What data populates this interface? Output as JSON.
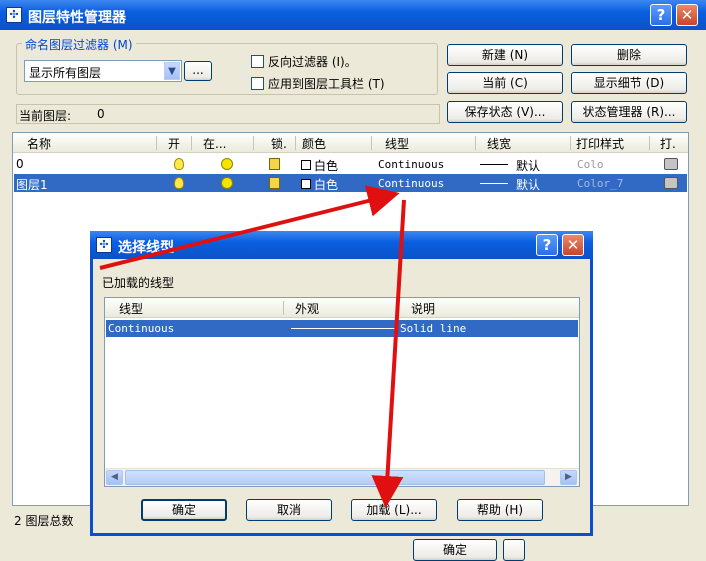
{
  "window": {
    "title": "图层特性管理器",
    "help": "?",
    "close": "✕"
  },
  "filter": {
    "group_label": "命名图层过滤器 (M)",
    "selected": "显示所有图层",
    "more": "...",
    "invert_label": "反向过滤器 (I)。",
    "apply_toolbar_label": "应用到图层工具栏 (T)"
  },
  "buttons": {
    "new": "新建 (N)",
    "delete": "删除",
    "current": "当前 (C)",
    "show_details": "显示细节 (D)",
    "save_state": "保存状态 (V)...",
    "state_manager": "状态管理器 (R)..."
  },
  "current_layer": {
    "label": "当前图层:",
    "value": "0"
  },
  "layer_table": {
    "columns": [
      "名称",
      "开",
      "在...",
      "锁.",
      "颜色",
      "线型",
      "线宽",
      "打印样式",
      "打."
    ],
    "rows": [
      {
        "name": "0",
        "color": "白色",
        "linetype": "Continuous",
        "lineweight": "默认",
        "plot_style": "Colo",
        "selected": false
      },
      {
        "name": "图层1",
        "color": "白色",
        "linetype": "Continuous",
        "lineweight": "默认",
        "plot_style": "Color_7",
        "selected": true
      }
    ]
  },
  "status": {
    "text": "2 图层总数"
  },
  "footer": {
    "ok": "确定"
  },
  "dialog": {
    "title": "选择线型",
    "help": "?",
    "close": "✕",
    "loaded_label": "已加载的线型",
    "columns": [
      "线型",
      "外观",
      "说明"
    ],
    "rows": [
      {
        "linetype": "Continuous",
        "description": "Solid line"
      }
    ],
    "ok": "确定",
    "cancel": "取消",
    "load": "加载 (L)...",
    "help_btn": "帮助 (H)"
  }
}
